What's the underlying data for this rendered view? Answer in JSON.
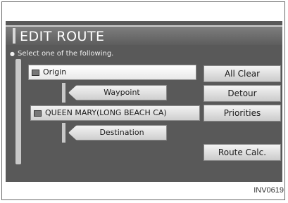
{
  "header": {
    "title": "EDIT ROUTE"
  },
  "instruction": "Select one of the following.",
  "route": {
    "origin": "Origin",
    "waypoint": "Waypoint",
    "location": "QUEEN MARY(LONG BEACH CA)",
    "destination": "Destination"
  },
  "buttons": {
    "all_clear": "All Clear",
    "detour": "Detour",
    "priorities": "Priorities",
    "route_calc": "Route Calc."
  },
  "caption": "INV0619",
  "colors": {
    "screen": "#595959",
    "button": "#d9d9d9",
    "text": "#1a1a1a"
  }
}
